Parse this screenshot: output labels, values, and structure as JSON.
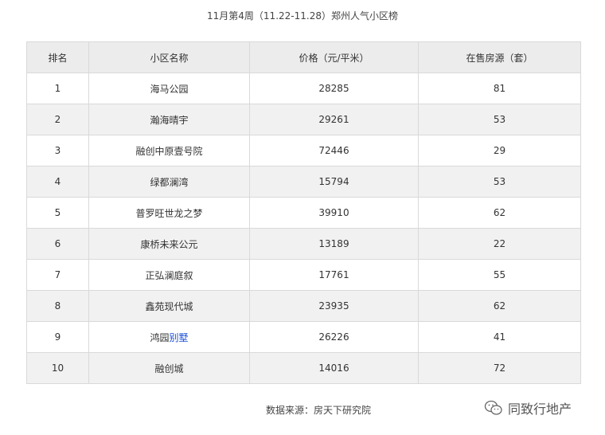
{
  "title": "11月第4周（11.22-11.28）郑州人气小区榜",
  "table": {
    "headers": [
      "排名",
      "小区名称",
      "价格（元/平米）",
      "在售房源（套）"
    ],
    "rows": [
      {
        "rank": "1",
        "name": "海马公园",
        "price": "28285",
        "stock": "81"
      },
      {
        "rank": "2",
        "name": "瀚海晴宇",
        "price": "29261",
        "stock": "53"
      },
      {
        "rank": "3",
        "name": "融创中原壹号院",
        "price": "72446",
        "stock": "29"
      },
      {
        "rank": "4",
        "name": "绿都澜湾",
        "price": "15794",
        "stock": "53"
      },
      {
        "rank": "5",
        "name": "普罗旺世龙之梦",
        "price": "39910",
        "stock": "62"
      },
      {
        "rank": "6",
        "name": "康桥未来公元",
        "price": "13189",
        "stock": "22"
      },
      {
        "rank": "7",
        "name": "正弘澜庭叙",
        "price": "17761",
        "stock": "55"
      },
      {
        "rank": "8",
        "name": "鑫苑现代城",
        "price": "23935",
        "stock": "62"
      },
      {
        "rank": "9",
        "name_prefix": "鸿园",
        "name_link": "别墅",
        "price": "26226",
        "stock": "41"
      },
      {
        "rank": "10",
        "name": "融创城",
        "price": "14016",
        "stock": "72"
      }
    ]
  },
  "source": "数据来源：房天下研究院",
  "watermark": {
    "icon": "wechat-icon",
    "text": "同致行地产"
  },
  "colors": {
    "header_bg": "#ececec",
    "stripe_bg": "#f1f1f1",
    "border": "#d9d9d9",
    "link": "#1a4fd6"
  }
}
